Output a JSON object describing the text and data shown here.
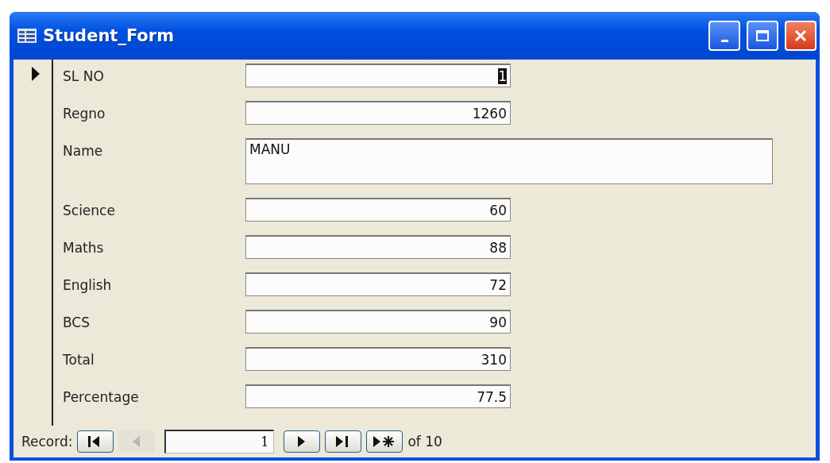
{
  "window": {
    "title": "Student_Form"
  },
  "fields": [
    {
      "label": "SL NO",
      "value": "1",
      "kind": "single",
      "focused": true
    },
    {
      "label": "Regno",
      "value": "1260",
      "kind": "single",
      "focused": false
    },
    {
      "label": "Name",
      "value": "MANU",
      "kind": "multi",
      "focused": false
    },
    {
      "label": "Science",
      "value": "60",
      "kind": "single",
      "focused": false
    },
    {
      "label": "Maths",
      "value": "88",
      "kind": "single",
      "focused": false
    },
    {
      "label": "English",
      "value": "72",
      "kind": "single",
      "focused": false
    },
    {
      "label": "BCS",
      "value": "90",
      "kind": "single",
      "focused": false
    },
    {
      "label": "Total",
      "value": "310",
      "kind": "single",
      "focused": false
    },
    {
      "label": "Percentage",
      "value": "77.5",
      "kind": "single",
      "focused": false
    }
  ],
  "navigation": {
    "label": "Record:",
    "current": "1",
    "total": "of 10",
    "buttons": [
      {
        "kind": "first",
        "disabled": false
      },
      {
        "kind": "previous",
        "disabled": true
      },
      {
        "kind": "current"
      },
      {
        "kind": "next",
        "disabled": false
      },
      {
        "kind": "last",
        "disabled": false
      },
      {
        "kind": "new",
        "disabled": false
      }
    ]
  }
}
